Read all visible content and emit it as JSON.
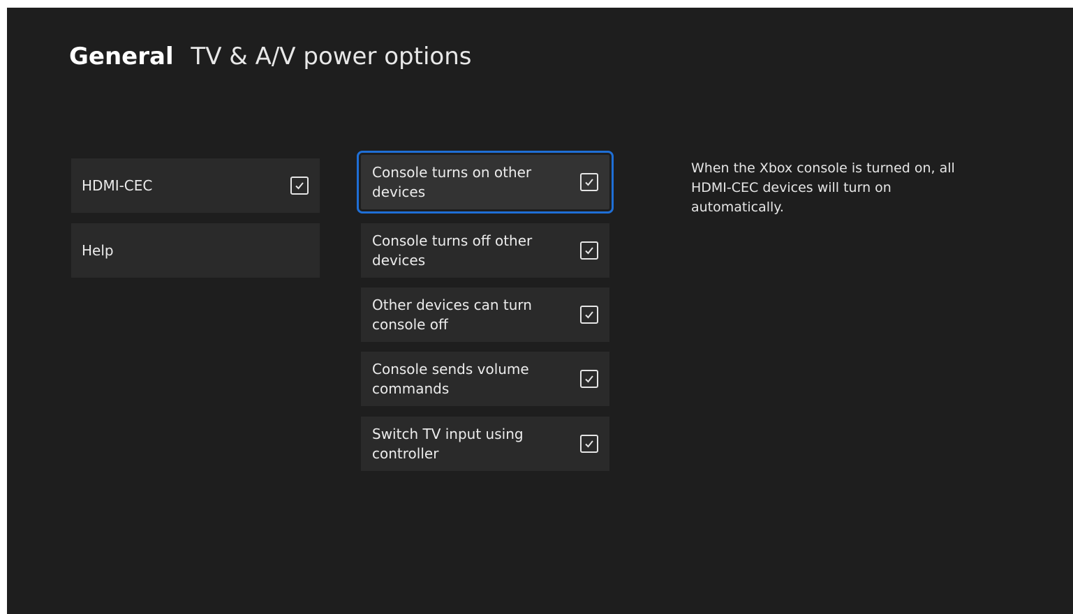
{
  "header": {
    "section": "General",
    "page": "TV & A/V power options"
  },
  "left_nav": [
    {
      "label": "HDMI-CEC",
      "checked": true,
      "icon": "checkbox-checked-icon"
    },
    {
      "label": "Help"
    }
  ],
  "options": [
    {
      "label": "Console turns on other devices",
      "checked": true,
      "focused": true
    },
    {
      "label": "Console turns off other devices",
      "checked": true
    },
    {
      "label": "Other devices can turn console off",
      "checked": true
    },
    {
      "label": "Console sends volume commands",
      "checked": true
    },
    {
      "label": "Switch TV input using controller",
      "checked": true
    }
  ],
  "description": "When the Xbox console is turned on, all HDMI-CEC devices will turn on automatically.",
  "colors": {
    "background": "#1e1e1e",
    "tile": "#2a2a2a",
    "focus": "#1f6fd6",
    "text": "#f2f2f2"
  }
}
